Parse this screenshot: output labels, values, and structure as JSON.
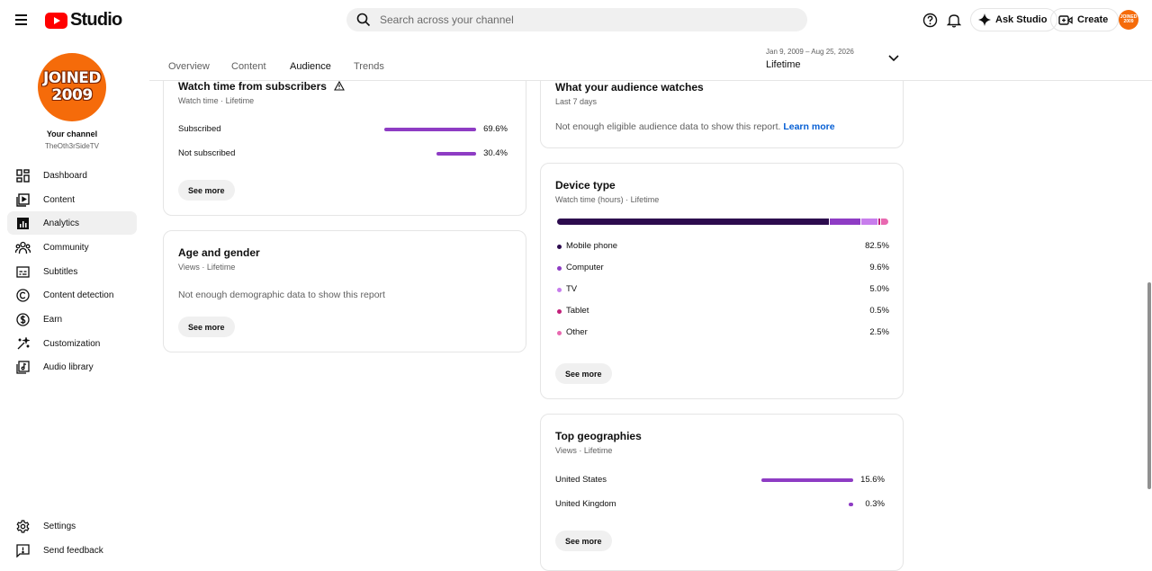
{
  "app": {
    "logo_text": "Studio",
    "search_placeholder": "Search across your channel",
    "ask_studio_label": "Ask Studio",
    "create_label": "Create",
    "avatar_text": "JOINED 2009"
  },
  "sidebar": {
    "avatar_line1": "JOINED",
    "avatar_line2": "2009",
    "your_channel": "Your channel",
    "channel_name": "TheOth3rSideTV",
    "items": [
      {
        "label": "Dashboard",
        "icon": "dashboard-icon"
      },
      {
        "label": "Content",
        "icon": "content-icon"
      },
      {
        "label": "Analytics",
        "icon": "analytics-icon",
        "active": true
      },
      {
        "label": "Community",
        "icon": "community-icon"
      },
      {
        "label": "Subtitles",
        "icon": "subtitles-icon"
      },
      {
        "label": "Content detection",
        "icon": "copyright-icon"
      },
      {
        "label": "Earn",
        "icon": "dollar-icon"
      },
      {
        "label": "Customization",
        "icon": "magic-wand-icon"
      },
      {
        "label": "Audio library",
        "icon": "audio-library-icon"
      }
    ],
    "bottom": [
      {
        "label": "Settings",
        "icon": "gear-icon"
      },
      {
        "label": "Send feedback",
        "icon": "feedback-icon"
      }
    ]
  },
  "tabs": [
    {
      "label": "Overview"
    },
    {
      "label": "Content"
    },
    {
      "label": "Audience",
      "active": true
    },
    {
      "label": "Trends"
    }
  ],
  "date_range": {
    "range": "Jan 9, 2009 – Aug 25, 2026",
    "value": "Lifetime"
  },
  "watch_subscribers": {
    "title": "Watch time from subscribers",
    "subtitle": "Watch time · Lifetime",
    "rows": [
      {
        "label": "Subscribed",
        "value": "69.6%",
        "fraction": 0.696
      },
      {
        "label": "Not subscribed",
        "value": "30.4%",
        "fraction": 0.304
      }
    ],
    "see_more": "See more"
  },
  "age_gender": {
    "title": "Age and gender",
    "subtitle": "Views · Lifetime",
    "message": "Not enough demographic data to show this report",
    "see_more": "See more"
  },
  "audience_watches": {
    "title": "What your audience watches",
    "subtitle": "Last 7 days",
    "message": "Not enough eligible audience data to show this report.",
    "link": "Learn more"
  },
  "device_type": {
    "title": "Device type",
    "subtitle": "Watch time (hours) · Lifetime",
    "rows": [
      {
        "label": "Mobile phone",
        "value": "82.5%",
        "fraction": 0.825,
        "color": "#2c0b4e"
      },
      {
        "label": "Computer",
        "value": "9.6%",
        "fraction": 0.096,
        "color": "#8e3cc4"
      },
      {
        "label": "TV",
        "value": "5.0%",
        "fraction": 0.05,
        "color": "#c77dec"
      },
      {
        "label": "Tablet",
        "value": "0.5%",
        "fraction": 0.005,
        "color": "#c2207a"
      },
      {
        "label": "Other",
        "value": "2.5%",
        "fraction": 0.025,
        "color": "#e868b0"
      }
    ],
    "see_more": "See more"
  },
  "top_geographies": {
    "title": "Top geographies",
    "subtitle": "Views · Lifetime",
    "rows": [
      {
        "label": "United States",
        "value": "15.6%",
        "fraction": 0.156
      },
      {
        "label": "United Kingdom",
        "value": "0.3%",
        "fraction": 0.003
      }
    ],
    "see_more": "See more"
  }
}
